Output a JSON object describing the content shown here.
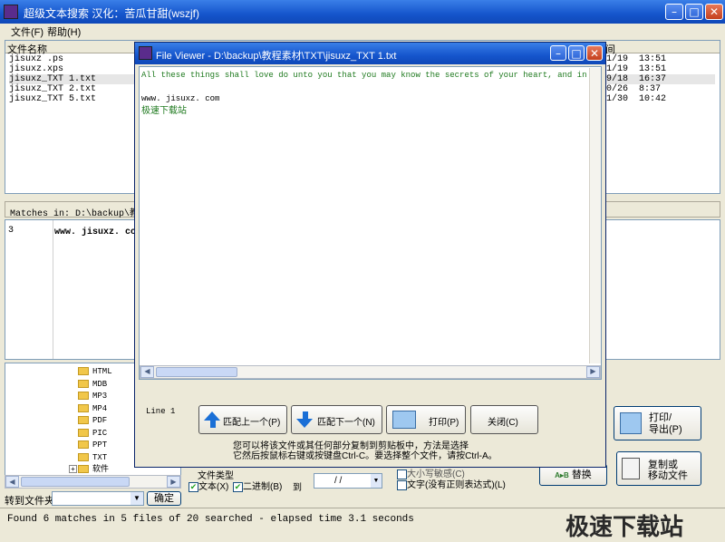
{
  "window": {
    "title": "超级文本搜索    汉化：苦瓜甘甜(wszjf)"
  },
  "menu": {
    "file": "文件(F)",
    "help": "帮助(H)"
  },
  "filelist": {
    "col_name": "文件名称",
    "col_time": "间",
    "rows": [
      {
        "name": "jisuxz .ps",
        "date": "1/19",
        "time": "13:51"
      },
      {
        "name": "jisuxz.xps",
        "date": "1/19",
        "time": "13:51"
      },
      {
        "name": "jisuxz_TXT 1.txt",
        "date": "9/18",
        "time": "16:37"
      },
      {
        "name": "jisuxz_TXT 2.txt",
        "date": "0/26",
        "time": "8:37"
      },
      {
        "name": "jisuxz_TXT 5.txt",
        "date": "1/30",
        "time": "10:42"
      }
    ]
  },
  "matches": {
    "header": "Matches in: D:\\backup\\教",
    "line_no": "3",
    "line_text": "www. jisuxz. com"
  },
  "tree": {
    "items": [
      "HTML",
      "MDB",
      "MP3",
      "MP4",
      "PDF",
      "PIC",
      "PPT",
      "TXT",
      "软件"
    ]
  },
  "goto": {
    "label": "转到文件夹",
    "confirm": "确定"
  },
  "options": {
    "file_type_label": "文件类型",
    "text_option": "文本(X)",
    "binary_option": "二进制(B)",
    "to_label": "到",
    "date_value": "/   /",
    "word_option": "文字(没有正则表达式)(L)",
    "hidden_option": "大小写敏感(C)"
  },
  "side_buttons": {
    "print_export": [
      "打印/",
      "导出(P)"
    ],
    "copy_move": [
      "复制或",
      "移动文件"
    ],
    "replace": "替换"
  },
  "status": "Found 6 matches in 5 files of 20 searched - elapsed time 3.1 seconds",
  "watermark": "极速下载站",
  "viewer": {
    "title": "File Viewer - D:\\backup\\教程素材\\TXT\\jisuxz_TXT 1.txt",
    "text_lines": [
      "All these things shall love do unto you that you may know the secrets of your heart, and in that know",
      "",
      "www. jisuxz. com",
      "极速下载站"
    ],
    "line_indicator": "Line 1",
    "btn_prev": "匹配上一个(P)",
    "btn_next": "匹配下一个(N)",
    "btn_print": "打印(P)",
    "btn_close": "关闭(C)",
    "hint_line1": "您可以将该文件或其任何部分复制到剪贴板中，方法是选择",
    "hint_line2": "它然后按鼠标右键或按键盘Ctrl-C。要选择整个文件，请按Ctrl-A。"
  }
}
